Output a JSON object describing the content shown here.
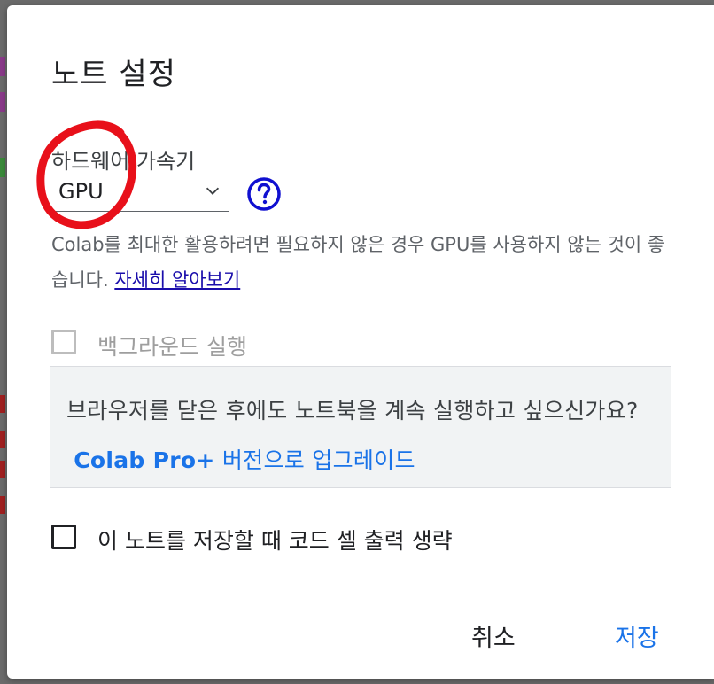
{
  "dialog": {
    "title": "노트 설정",
    "accelerator": {
      "label": "하드웨어 가속기",
      "selected": "GPU",
      "note_text": "Colab를 최대한 활용하려면 필요하지 않은 경우 GPU를 사용하지 않는 것이 좋습니다. ",
      "note_link": "자세히 알아보기"
    },
    "background_execution": {
      "label": "백그라운드 실행",
      "checked": false,
      "disabled": true,
      "promo_text": "브라우저를 닫은 후에도 노트북을 계속 실행하고 싶으신가요?",
      "promo_pro": "Colab Pro+",
      "promo_upgrade": "버전으로 업그레이드"
    },
    "omit_output": {
      "label": "이 노트를 저장할 때 코드 셀 출력 생략",
      "checked": false
    },
    "buttons": {
      "cancel": "취소",
      "save": "저장"
    }
  },
  "colors": {
    "accent": "#1a73e8",
    "annotation_red": "#e8101a",
    "help_icon": "#1010d0"
  },
  "icons": {
    "dropdown": "chevron-down-icon",
    "help": "help-circle-icon"
  }
}
